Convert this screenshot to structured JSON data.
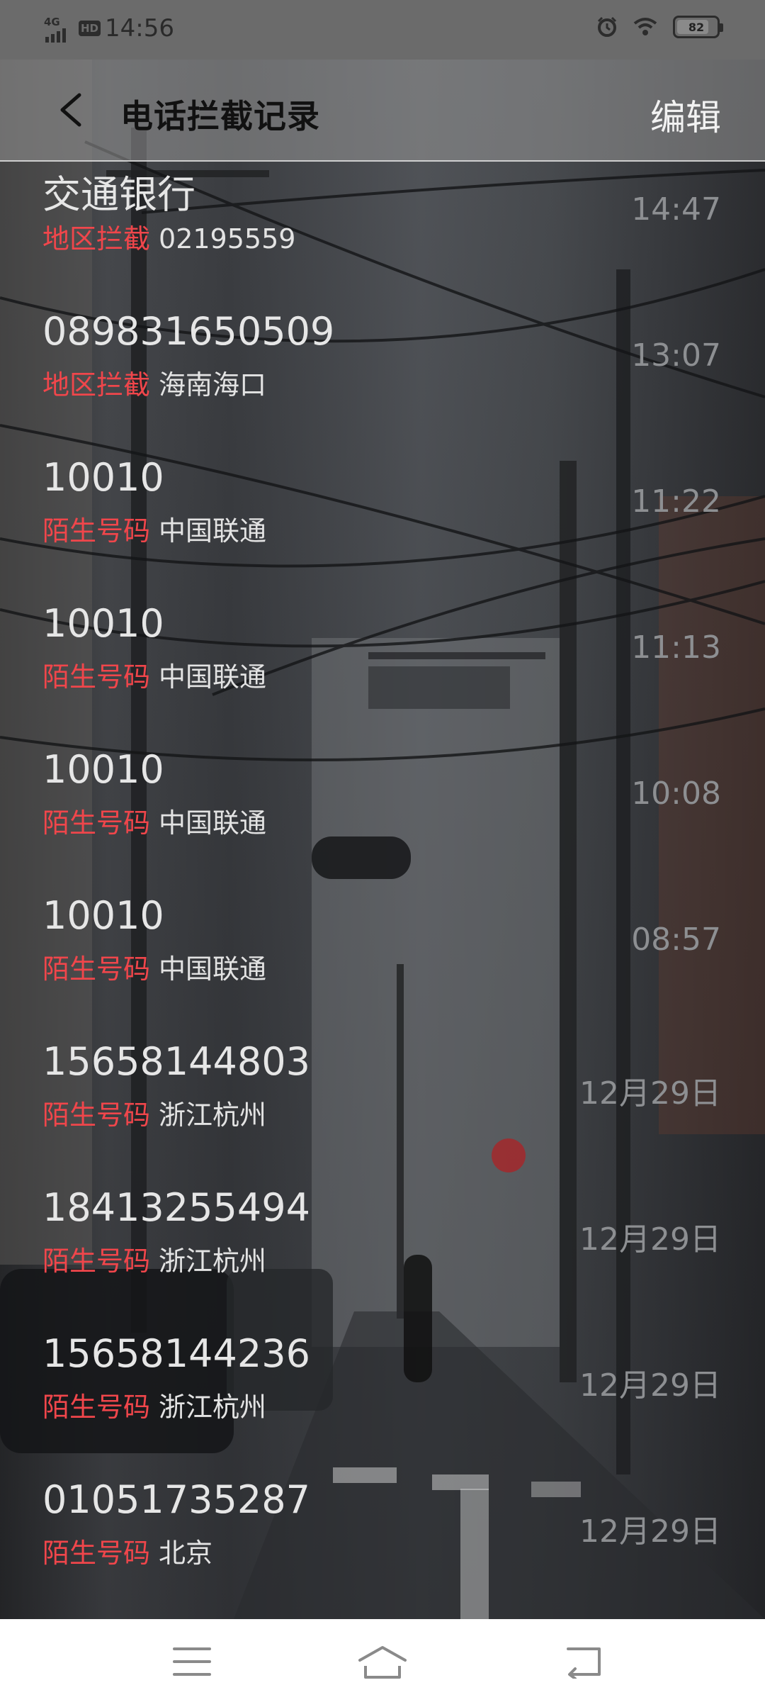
{
  "status_bar": {
    "network": "4G",
    "hd": "HD",
    "time": "14:56",
    "battery_level": "82",
    "battery_fraction": 0.82,
    "icons": [
      "signal-icon",
      "hd-icon",
      "alarm-icon",
      "wifi-icon",
      "battery-icon"
    ]
  },
  "header": {
    "title": "电话拦截记录",
    "edit_label": "编辑",
    "back_icon": "chevron-left-icon"
  },
  "blocked_calls": [
    {
      "name": "交通银行",
      "tag": "地区拦截",
      "detail": "02195559",
      "time": "14:47"
    },
    {
      "name": "089831650509",
      "tag": "地区拦截",
      "detail": "海南海口",
      "time": "13:07"
    },
    {
      "name": "10010",
      "tag": "陌生号码",
      "detail": "中国联通",
      "time": "11:22"
    },
    {
      "name": "10010",
      "tag": "陌生号码",
      "detail": "中国联通",
      "time": "11:13"
    },
    {
      "name": "10010",
      "tag": "陌生号码",
      "detail": "中国联通",
      "time": "10:08"
    },
    {
      "name": "10010",
      "tag": "陌生号码",
      "detail": "中国联通",
      "time": "08:57"
    },
    {
      "name": "15658144803",
      "tag": "陌生号码",
      "detail": "浙江杭州",
      "time": "12月29日"
    },
    {
      "name": "18413255494",
      "tag": "陌生号码",
      "detail": "浙江杭州",
      "time": "12月29日"
    },
    {
      "name": "15658144236",
      "tag": "陌生号码",
      "detail": "浙江杭州",
      "time": "12月29日"
    },
    {
      "name": "01051735287",
      "tag": "陌生号码",
      "detail": "北京",
      "time": "12月29日"
    }
  ],
  "nav_bar": {
    "icons": [
      "menu-icon",
      "home-icon",
      "back-arrow-icon"
    ]
  },
  "colors": {
    "tag_red": "#f0464b",
    "time_gray": "#8d8f92",
    "status_bar_bg": "#6b6b6b"
  }
}
